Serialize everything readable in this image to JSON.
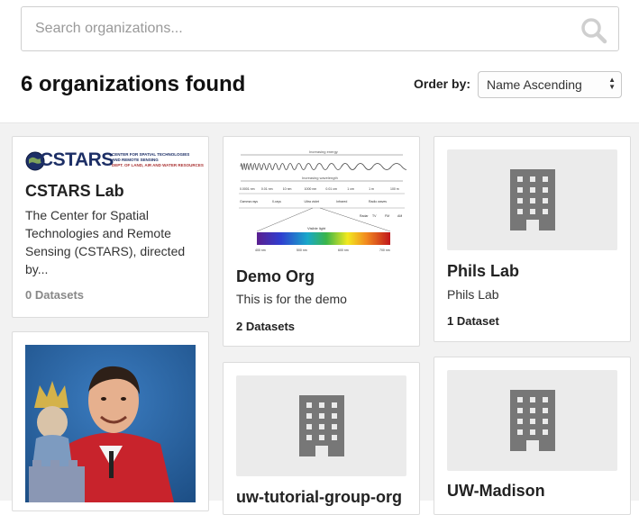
{
  "search": {
    "placeholder": "Search organizations..."
  },
  "results": {
    "heading": "6 organizations found"
  },
  "sort": {
    "label": "Order by:",
    "selected": "Name Ascending"
  },
  "organizations": [
    {
      "title": "CSTARS Lab",
      "logo_text": "CSTARS",
      "logo_subtitle_1": "CENTER FOR SPATIAL TECHNOLOGIES",
      "logo_subtitle_2": "AND REMOTE SENSING",
      "logo_subtitle_3": "DEPT. OF LAND, AIR AND WATER RESOURCES",
      "description": "The Center for Spatial Technologies and Remote Sensing (CSTARS), directed by...",
      "datasets": "0 Datasets"
    },
    {
      "title": "Demo Org",
      "description": "This is for the demo",
      "datasets": "2 Datasets",
      "image_labels": {
        "increasing_energy": "Increasing energy",
        "increasing_wavelength": "Increasing wavelength",
        "scale": [
          "0.0001 nm",
          "0.01 nm",
          "10 nm",
          "1000 nm",
          "0.01 cm",
          "1 cm",
          "1 m",
          "100 m"
        ],
        "bands": [
          "Gamma rays",
          "X-rays",
          "Ultra violet",
          "Infrared",
          "Radio waves"
        ],
        "radio": [
          "Radar",
          "TV",
          "FM",
          "AM"
        ],
        "visible_light": "Visible light",
        "visible_scale": [
          "400 nm",
          "500 nm",
          "600 nm",
          "700 nm"
        ]
      }
    },
    {
      "title": "Phils Lab",
      "description": "Phils Lab",
      "datasets": "1 Dataset"
    },
    {
      "title": "uw-tutorial-group-org"
    },
    {
      "title": "UW-Madison"
    }
  ],
  "icons": {
    "search": "search-icon",
    "placeholder": "building-icon"
  },
  "colors": {
    "background": "#f2f2f2",
    "card_border": "#dcdcdc",
    "placeholder": "#ebebeb",
    "icon": "#777777"
  }
}
